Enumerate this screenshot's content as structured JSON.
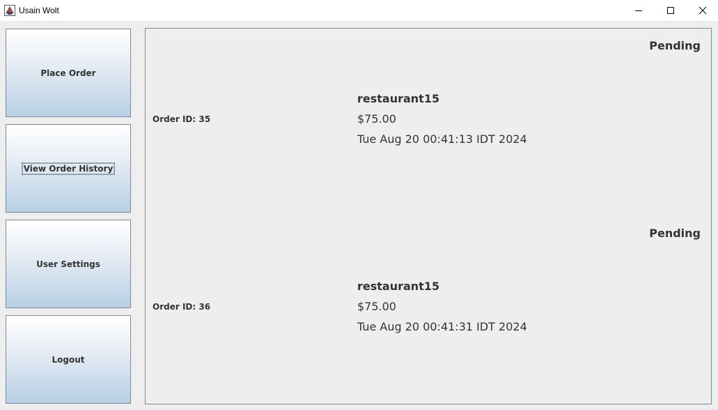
{
  "window": {
    "title": "Usain Wolt",
    "minimize_icon": "minimize-icon",
    "maximize_icon": "maximize-icon",
    "close_icon": "close-icon"
  },
  "sidebar": {
    "buttons": [
      {
        "label": "Place Order"
      },
      {
        "label": "View Order History"
      },
      {
        "label": "User Settings"
      },
      {
        "label": "Logout"
      }
    ]
  },
  "orders": [
    {
      "status": "Pending",
      "order_id": "Order ID: 35",
      "restaurant": "restaurant15",
      "price": "$75.00",
      "date": "Tue Aug 20 00:41:13 IDT 2024"
    },
    {
      "status": "Pending",
      "order_id": "Order ID: 36",
      "restaurant": "restaurant15",
      "price": "$75.00",
      "date": "Tue Aug 20 00:41:31 IDT 2024"
    }
  ]
}
